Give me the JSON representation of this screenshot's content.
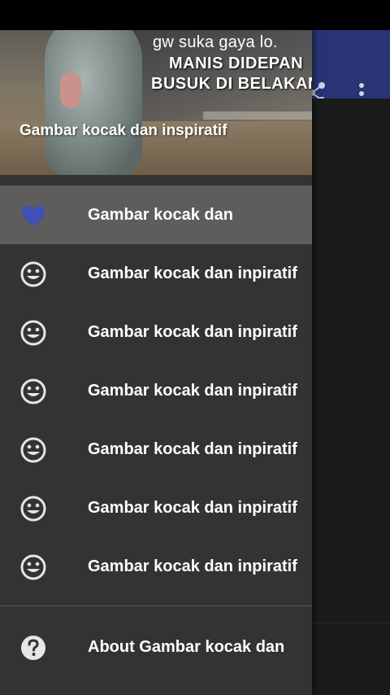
{
  "header": {
    "meme_line1": "gw suka gaya lo.",
    "meme_line2": "MANIS DIDEPAN",
    "meme_line3": "BUSUK DI BELAKANG",
    "title": "Gambar kocak dan inspiratif"
  },
  "menu": {
    "items": [
      {
        "label": "Gambar kocak dan",
        "icon": "heart-icon",
        "selected": true
      },
      {
        "label": "Gambar kocak dan inpiratif",
        "icon": "smiley-icon"
      },
      {
        "label": "Gambar kocak dan inpiratif",
        "icon": "smiley-icon"
      },
      {
        "label": "Gambar kocak dan inpiratif",
        "icon": "smiley-icon"
      },
      {
        "label": "Gambar kocak dan inpiratif",
        "icon": "smiley-icon"
      },
      {
        "label": "Gambar kocak dan inpiratif",
        "icon": "smiley-icon"
      },
      {
        "label": "Gambar kocak dan inpiratif",
        "icon": "smiley-icon"
      }
    ],
    "about_label": "About Gambar kocak dan"
  },
  "app_bar": {
    "icons": [
      "share-icon",
      "more-vert-icon"
    ]
  },
  "colors": {
    "accent": "#3f51b5",
    "app_bar": "#2a3474",
    "drawer": "#333333",
    "selected_row": "#5d5d5d"
  }
}
